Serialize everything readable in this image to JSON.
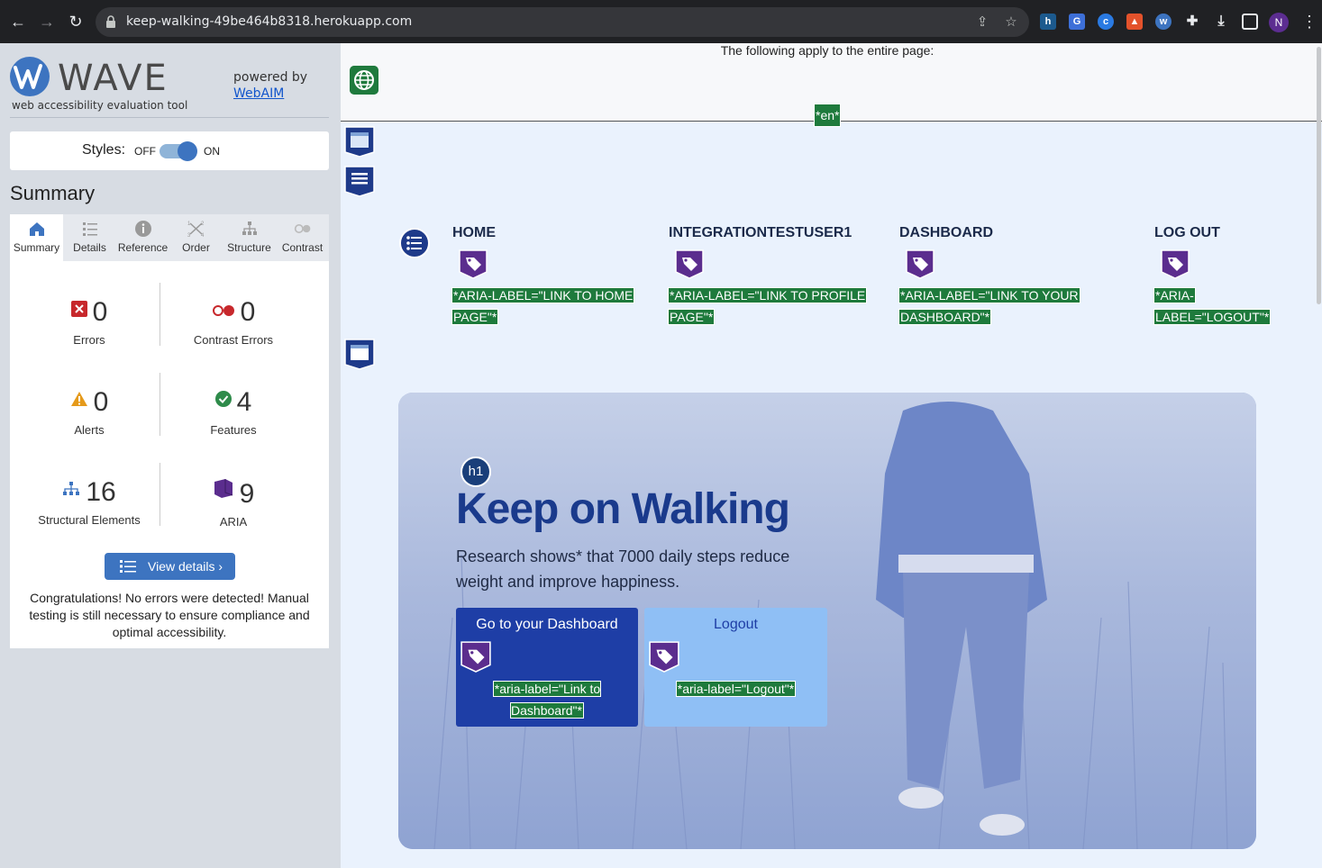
{
  "browser": {
    "url": "keep-walking-49be464b8318.herokuapp.com",
    "profile_initial": "N"
  },
  "wave": {
    "brand": "WAVE",
    "subtitle": "web accessibility evaluation tool",
    "powered_by": "powered by",
    "webaim_link": "WebAIM",
    "styles_label": "Styles:",
    "styles_off": "OFF",
    "styles_on": "ON",
    "section_title": "Summary",
    "tabs": [
      {
        "label": "Summary",
        "icon": "home-icon"
      },
      {
        "label": "Details",
        "icon": "list-icon"
      },
      {
        "label": "Reference",
        "icon": "info-icon"
      },
      {
        "label": "Order",
        "icon": "order-icon"
      },
      {
        "label": "Structure",
        "icon": "structure-icon"
      },
      {
        "label": "Contrast",
        "icon": "contrast-icon"
      }
    ],
    "stats": {
      "errors": {
        "value": "0",
        "label": "Errors"
      },
      "contrast_errors": {
        "value": "0",
        "label": "Contrast Errors"
      },
      "alerts": {
        "value": "0",
        "label": "Alerts"
      },
      "features": {
        "value": "4",
        "label": "Features"
      },
      "structural": {
        "value": "16",
        "label": "Structural Elements"
      },
      "aria": {
        "value": "9",
        "label": "ARIA"
      }
    },
    "view_details": "View details ›",
    "congrats": "Congratulations! No errors were detected! Manual testing is still necessary to ensure compliance and optimal accessibility."
  },
  "page": {
    "applies_text": "The following apply to the entire page:",
    "lang_tag": "*en*",
    "nav": [
      {
        "label": "HOME",
        "aria": "*ARIA-LABEL=\"LINK TO HOME PAGE\"*"
      },
      {
        "label": "INTEGRATIONTESTUSER1",
        "aria": "*ARIA-LABEL=\"LINK TO PROFILE PAGE\"*"
      },
      {
        "label": "DASHBOARD",
        "aria": "*ARIA-LABEL=\"LINK TO YOUR DASHBOARD\"*"
      },
      {
        "label": "LOG OUT",
        "aria": "*ARIA-LABEL=\"LOGOUT\"*"
      }
    ],
    "h1_badge": "h1",
    "hero_title": "Keep on Walking",
    "hero_text": "Research shows* that 7000 daily steps reduce weight and improve happiness.",
    "dashboard_button": "Go to your Dashboard",
    "dashboard_aria": "*aria-label=\"Link to Dashboard\"*",
    "logout_button": "Logout",
    "logout_aria": "*aria-label=\"Logout\"*"
  },
  "colors": {
    "wave_blue": "#3d74c0",
    "aria_purple": "#5b2d8e",
    "feature_green": "#1e7a3c",
    "hero_title": "#1a3a8c",
    "dashboard_btn": "#1e3ea6",
    "logout_btn": "#8fbff5"
  }
}
